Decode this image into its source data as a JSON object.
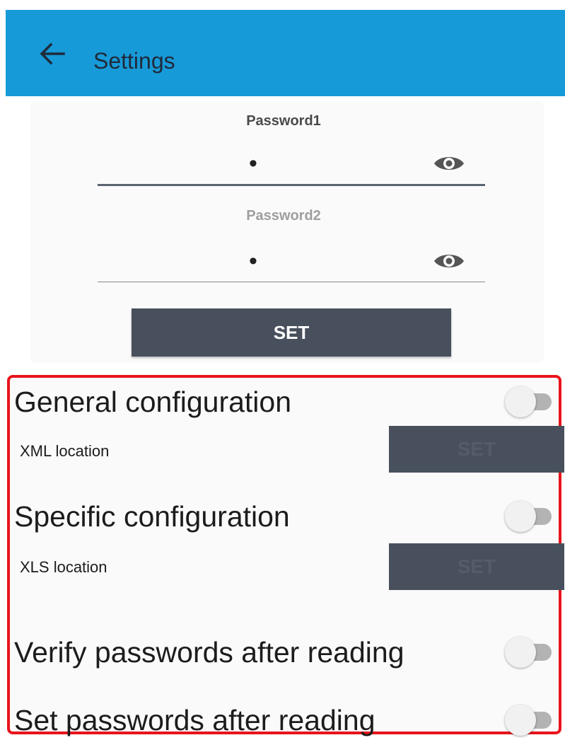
{
  "appbar": {
    "title": "Settings",
    "back_icon": "arrow-back-icon",
    "color": "#179ad8"
  },
  "passwords": {
    "password1_label": "Password1",
    "password1_value": "•",
    "password2_label": "Password2",
    "password2_value": "•",
    "visibility_icon": "eye-icon",
    "set_label": "SET"
  },
  "config": {
    "general": {
      "title": "General configuration",
      "enabled": false,
      "location_label": "XML location",
      "set_label": "SET"
    },
    "specific": {
      "title": "Specific configuration",
      "enabled": false,
      "location_label": "XLS location",
      "set_label": "SET"
    },
    "verify": {
      "title": "Verify passwords after reading",
      "enabled": false
    },
    "set_after": {
      "title": "Set passwords after reading",
      "enabled": false
    },
    "highlight_color": "#e8141b"
  }
}
